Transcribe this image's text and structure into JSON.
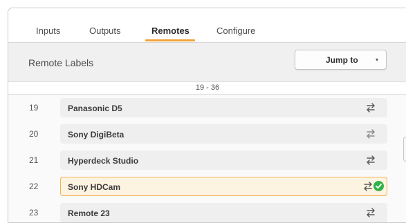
{
  "tabs": [
    {
      "label": "Inputs"
    },
    {
      "label": "Outputs"
    },
    {
      "label": "Remotes",
      "active": true
    },
    {
      "label": "Configure"
    }
  ],
  "header": {
    "title": "Remote Labels",
    "jump_label": "Jump to",
    "jump_caret": "▾"
  },
  "range": "19 - 36",
  "rows": [
    {
      "num": "19",
      "label": "Panasonic D5"
    },
    {
      "num": "20",
      "label": "Sony DigiBeta"
    },
    {
      "num": "21",
      "label": "Hyperdeck Studio"
    },
    {
      "num": "22",
      "label": "Sony HDCam",
      "selected": true
    },
    {
      "num": "23",
      "label": "Remote 23"
    }
  ],
  "icons": {
    "swap": "swap-arrows-icon",
    "check": "check-circle-icon"
  },
  "colors": {
    "accent": "#f0a33c",
    "selected_bg": "#fdf3e1",
    "check": "#34b24a"
  }
}
